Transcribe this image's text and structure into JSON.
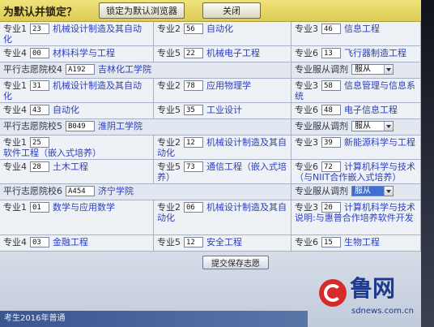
{
  "topbar": {
    "prompt": "为默认并锁定？",
    "lock_button": "锁定为默认浏览器",
    "close_button": "关闭"
  },
  "labels": {
    "adjust": "专业服从调剂"
  },
  "blocks": [
    {
      "majors": [
        {
          "label": "专业1",
          "code": "23",
          "name": "机械设计制造及其自动化"
        },
        {
          "label": "专业2",
          "code": "56",
          "name": "自动化"
        },
        {
          "label": "专业3",
          "code": "46",
          "name": "信息工程"
        },
        {
          "label": "专业4",
          "code": "00",
          "name": "材料科学与工程"
        },
        {
          "label": "专业5",
          "code": "22",
          "name": "机械电子工程"
        },
        {
          "label": "专业6",
          "code": "13",
          "name": "飞行器制造工程"
        }
      ]
    },
    {
      "school_label": "平行志愿院校4",
      "school_code": "A192",
      "school_name": "吉林化工学院",
      "adjust_value": "服从",
      "majors": [
        {
          "label": "专业1",
          "code": "31",
          "name": "机械设计制造及其自动化"
        },
        {
          "label": "专业2",
          "code": "78",
          "name": "应用物理学"
        },
        {
          "label": "专业3",
          "code": "58",
          "name": "信息管理与信息系统"
        },
        {
          "label": "专业4",
          "code": "43",
          "name": "自动化"
        },
        {
          "label": "专业5",
          "code": "35",
          "name": "工业设计"
        },
        {
          "label": "专业6",
          "code": "48",
          "name": "电子信息工程"
        }
      ]
    },
    {
      "school_label": "平行志愿院校5",
      "school_code": "B049",
      "school_name": "淮阴工学院",
      "adjust_value": "服从",
      "majors": [
        {
          "label": "专业1",
          "code": "25",
          "name": "软件工程（嵌入式培养）"
        },
        {
          "label": "专业2",
          "code": "12",
          "name": "机械设计制造及其自动化"
        },
        {
          "label": "专业3",
          "code": "39",
          "name": "新能源科学与工程"
        },
        {
          "label": "专业4",
          "code": "28",
          "name": "土木工程"
        },
        {
          "label": "专业5",
          "code": "73",
          "name": "通信工程（嵌入式培养）"
        },
        {
          "label": "专业6",
          "code": "72",
          "name": "计算机科学与技术（与NIIT合作嵌入式培养）"
        }
      ]
    },
    {
      "school_label": "平行志愿院校6",
      "school_code": "A454",
      "school_name": "济宁学院",
      "adjust_value": "服从",
      "majors": [
        {
          "label": "专业1",
          "code": "01",
          "name": "数学与应用数学"
        },
        {
          "label": "专业2",
          "code": "06",
          "name": "机械设计制造及其自动化"
        },
        {
          "label": "专业3",
          "code": "20",
          "name": "计算机科学与技术 说明:与惠普合作培养软件开发"
        },
        {
          "label": "专业4",
          "code": "03",
          "name": "金融工程"
        },
        {
          "label": "专业5",
          "code": "12",
          "name": "安全工程"
        },
        {
          "label": "专业6",
          "code": "15",
          "name": "生物工程"
        }
      ]
    }
  ],
  "submit_button": "提交保存志愿",
  "taskbar": {
    "text": "考生2016年普通"
  },
  "watermark": {
    "brand": "鲁网",
    "site": "sdnews.com.cn"
  },
  "colors": {
    "topbar": "#e4d468",
    "link": "#2b3fbf",
    "select_highlight": "#3f6fd1",
    "brand": "#1d3a8c",
    "logo": "#d62b2b"
  }
}
